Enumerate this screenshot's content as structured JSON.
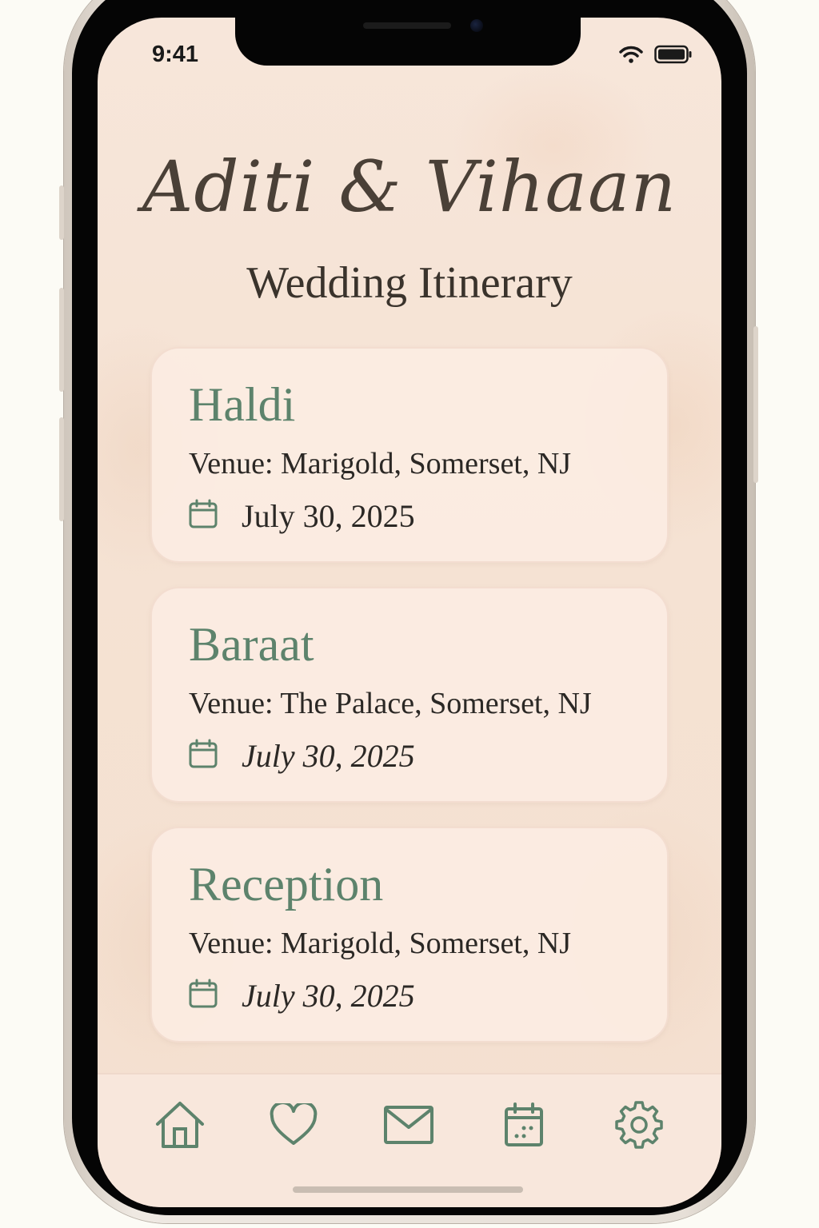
{
  "status_bar": {
    "time": "9:41",
    "icons": [
      "wifi-icon",
      "battery-icon"
    ]
  },
  "header": {
    "title": "Aditi & Vihaan",
    "subtitle": "Wedding Itinerary"
  },
  "events": [
    {
      "name": "Haldi",
      "venue": "Venue: Marigold, Somerset, NJ",
      "date": "July 30, 2025",
      "icon": "calendar-icon"
    },
    {
      "name": "Baraat",
      "venue": "Venue: The Palace, Somerset, NJ",
      "date": "July 30, 2025",
      "icon": "calendar-icon"
    },
    {
      "name": "Reception",
      "venue": "Venue: Marigold, Somerset, NJ",
      "date": "July 30, 2025",
      "icon": "calendar-icon"
    }
  ],
  "tab_bar": {
    "items": [
      "home-icon",
      "heart-icon",
      "mail-icon",
      "calendar-icon",
      "gear-icon"
    ]
  },
  "colors": {
    "accent_green": "#5d836c",
    "background": "#f5e2d3",
    "card": "#fcece2",
    "text_dark": "#2b2825",
    "title": "#4a4037"
  }
}
